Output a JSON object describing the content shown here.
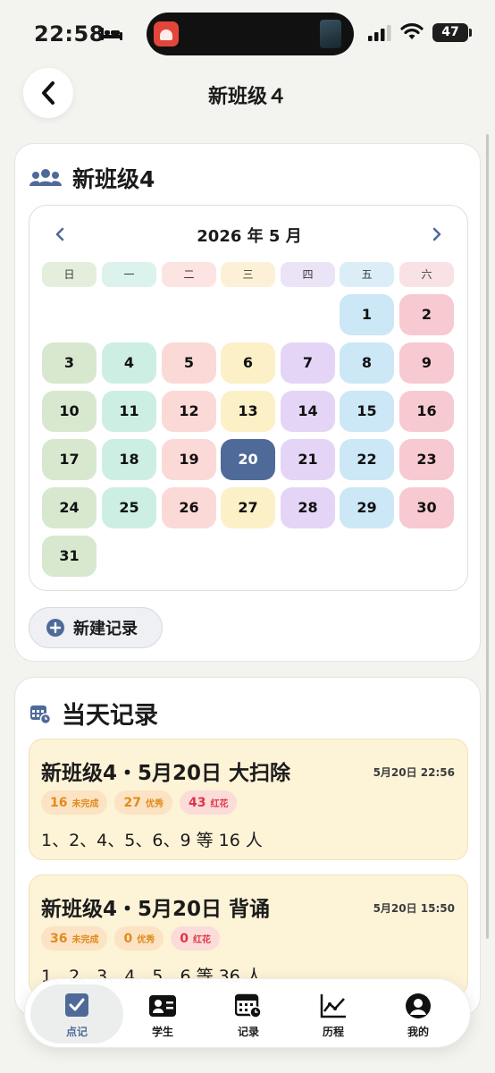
{
  "status_bar": {
    "time": "22:58",
    "battery": "47"
  },
  "nav": {
    "title": "新班级４"
  },
  "class_card": {
    "title": "新班级4",
    "calendar": {
      "month_label": "2026 年 5 月",
      "weekdays": [
        "日",
        "一",
        "二",
        "三",
        "四",
        "五",
        "六"
      ],
      "days": [
        "1",
        "2",
        "3",
        "4",
        "5",
        "6",
        "7",
        "8",
        "9",
        "10",
        "11",
        "12",
        "13",
        "14",
        "15",
        "16",
        "17",
        "18",
        "19",
        "20",
        "21",
        "22",
        "23",
        "24",
        "25",
        "26",
        "27",
        "28",
        "29",
        "30",
        "31"
      ],
      "selected_day": "20"
    },
    "new_record_label": "新建记录"
  },
  "records": {
    "title": "当天记录",
    "items": [
      {
        "title": "新班级4・5月20日 大扫除",
        "time": "5月20日 22:56",
        "badges": [
          {
            "num": "16",
            "label": "未完成"
          },
          {
            "num": "27",
            "label": "优秀"
          },
          {
            "num": "43",
            "label": "红花"
          }
        ],
        "students": "1、2、4、5、6、9 等 16 人"
      },
      {
        "title": "新班级4・5月20日 背诵",
        "time": "5月20日 15:50",
        "badges": [
          {
            "num": "36",
            "label": "未完成"
          },
          {
            "num": "0",
            "label": "优秀"
          },
          {
            "num": "0",
            "label": "红花"
          }
        ],
        "students": "1、2、3、4、5、6 等 36 人"
      }
    ]
  },
  "tab_bar": {
    "tabs": [
      {
        "label": "点记"
      },
      {
        "label": "学生"
      },
      {
        "label": "记录"
      },
      {
        "label": "历程"
      },
      {
        "label": "我的"
      }
    ],
    "active_tab": "点记"
  },
  "colors": {
    "accent": "#4f6a99",
    "weekday_col_bg": [
      "#e3eedd",
      "#dcf2ec",
      "#fbe4e2",
      "#fcf1d6",
      "#ebe3f6",
      "#dbeef8",
      "#f8e2e5"
    ],
    "day_col_bg": [
      "#d8e8cf",
      "#cdeee3",
      "#fbd9d6",
      "#fcf0c7",
      "#e4d5f6",
      "#cce7f6",
      "#f7c9d0"
    ]
  }
}
